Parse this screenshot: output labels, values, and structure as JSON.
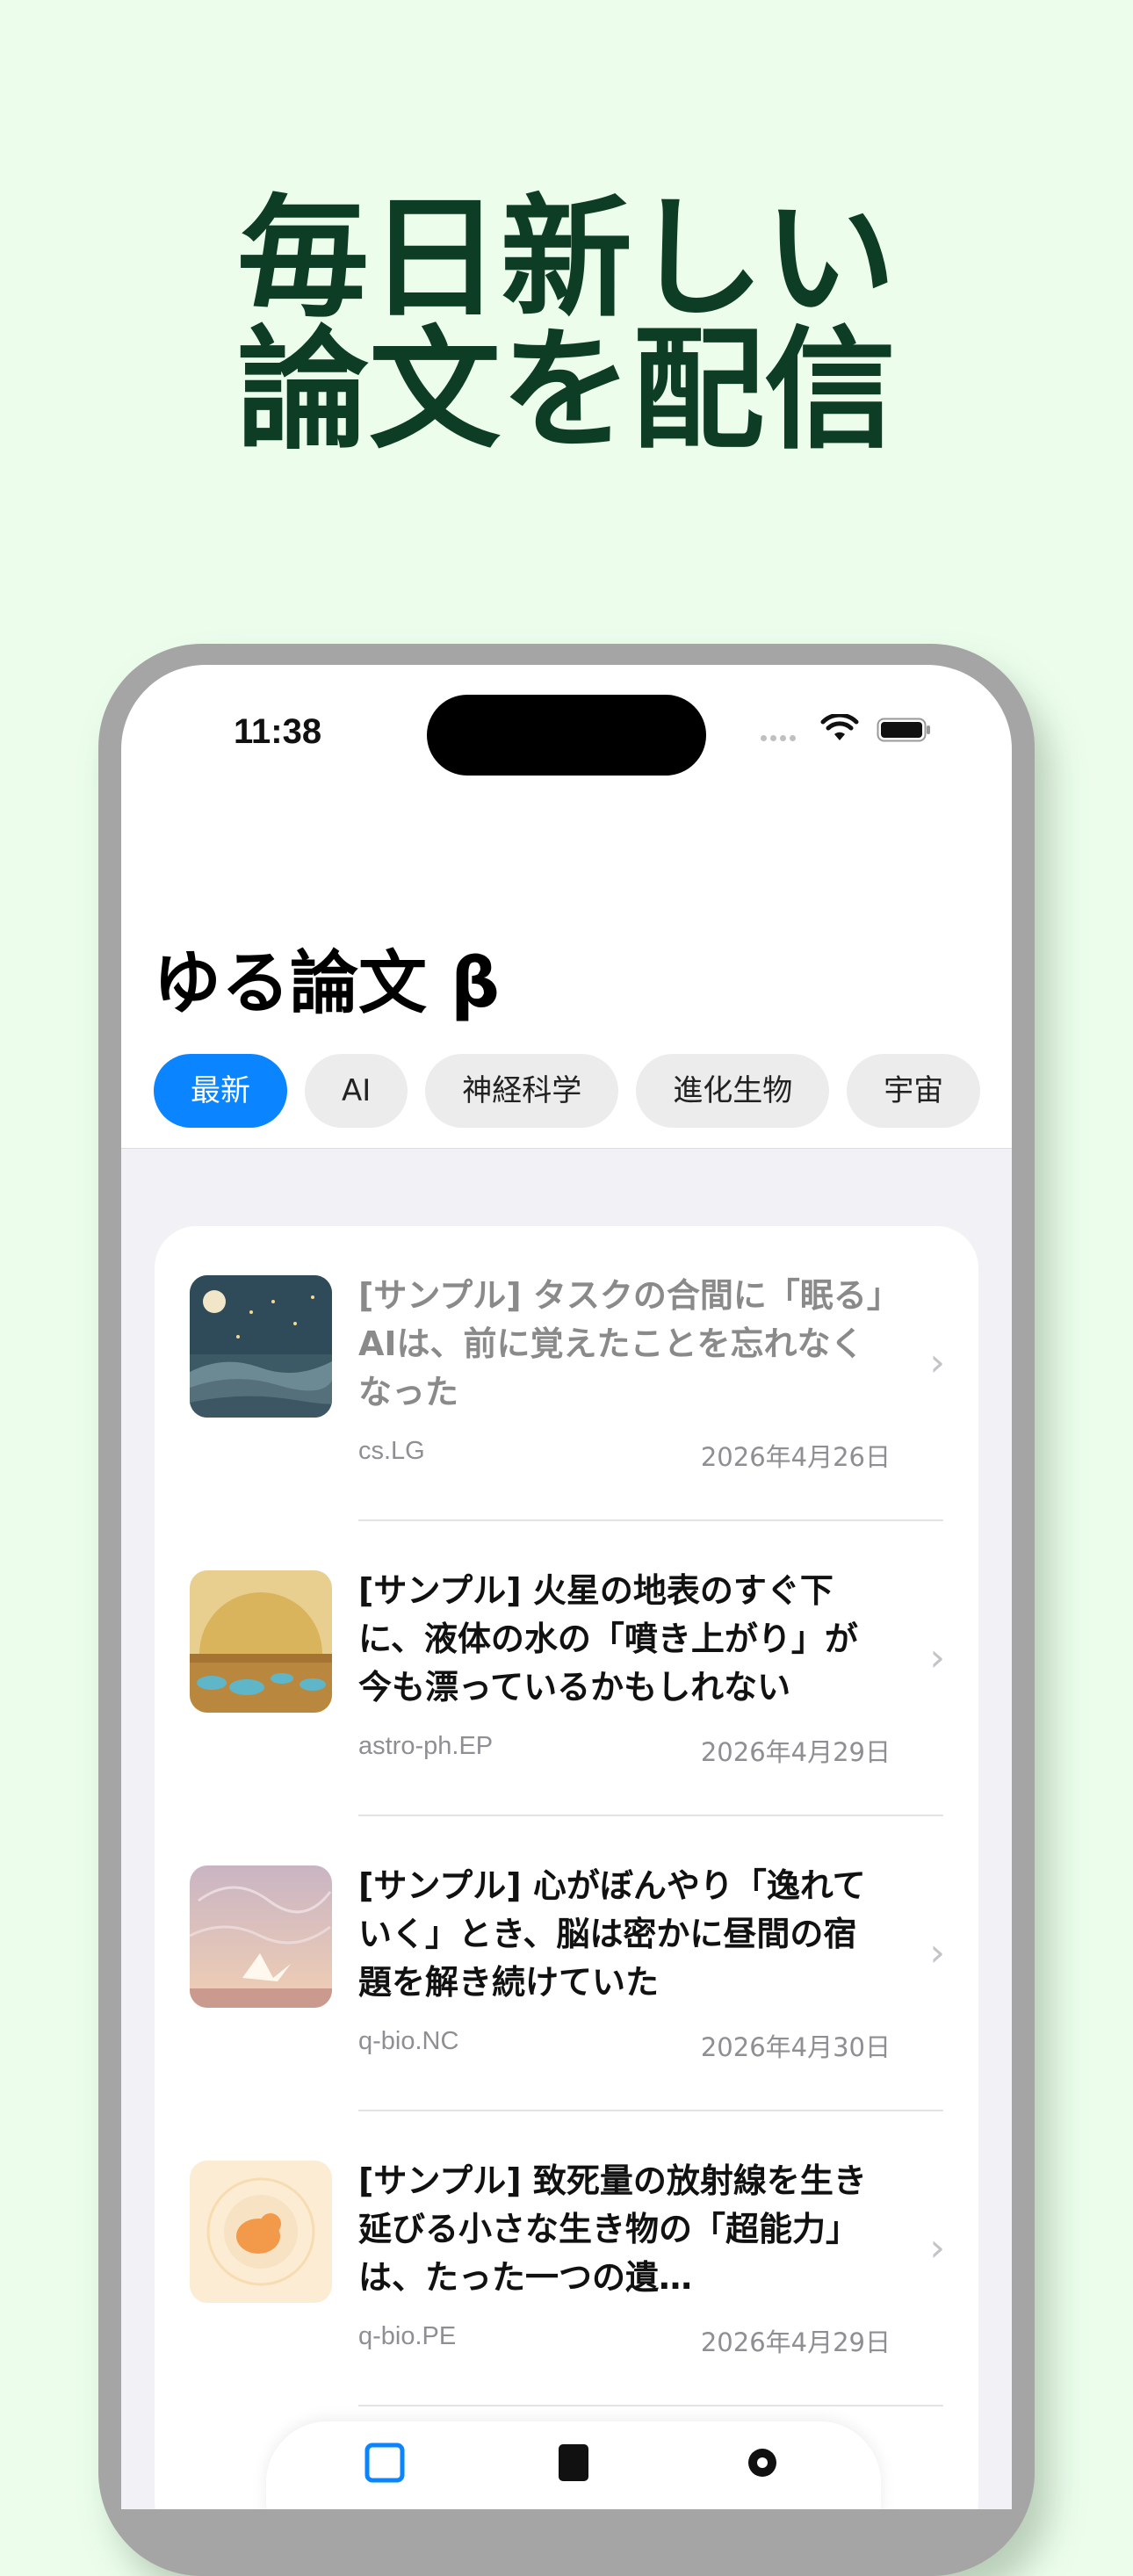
{
  "promo": {
    "line1": "毎日新しい",
    "line2": "論文を配信"
  },
  "status_bar": {
    "time": "11:38"
  },
  "app": {
    "title": "ゆる論文 β"
  },
  "filters": [
    {
      "label": "最新",
      "active": true
    },
    {
      "label": "AI",
      "active": false
    },
    {
      "label": "神経科学",
      "active": false
    },
    {
      "label": "進化生物",
      "active": false
    },
    {
      "label": "宇宙",
      "active": false
    }
  ],
  "articles": [
    {
      "title": "[サンプル] タスクの合間に「眠る」AIは、前に覚えたことを忘れなくなった",
      "category": "cs.LG",
      "date": "2026年4月26日",
      "read": true,
      "thumbnail": "night-sky-hills"
    },
    {
      "title": "[サンプル] 火星の地表のすぐ下に、液体の水の「噴き上がり」が今も漂っているかもしれない",
      "category": "astro-ph.EP",
      "date": "2026年4月29日",
      "read": false,
      "thumbnail": "mars-surface-pools"
    },
    {
      "title": "[サンプル] 心がぼんやり「逸れていく」とき、脳は密かに昼間の宿題を解き続けていた",
      "category": "q-bio.NC",
      "date": "2026年4月30日",
      "read": false,
      "thumbnail": "paper-crane-clouds"
    },
    {
      "title": "[サンプル] 致死量の放射線を生き延びる小さな生き物の「超能力」は、たった一つの遺…",
      "category": "q-bio.PE",
      "date": "2026年4月29日",
      "read": false,
      "thumbnail": "tardigrade-bubble"
    }
  ],
  "colors": {
    "background": "#ecfdec",
    "headline": "#0e3d26",
    "accent": "#0a84ff"
  }
}
